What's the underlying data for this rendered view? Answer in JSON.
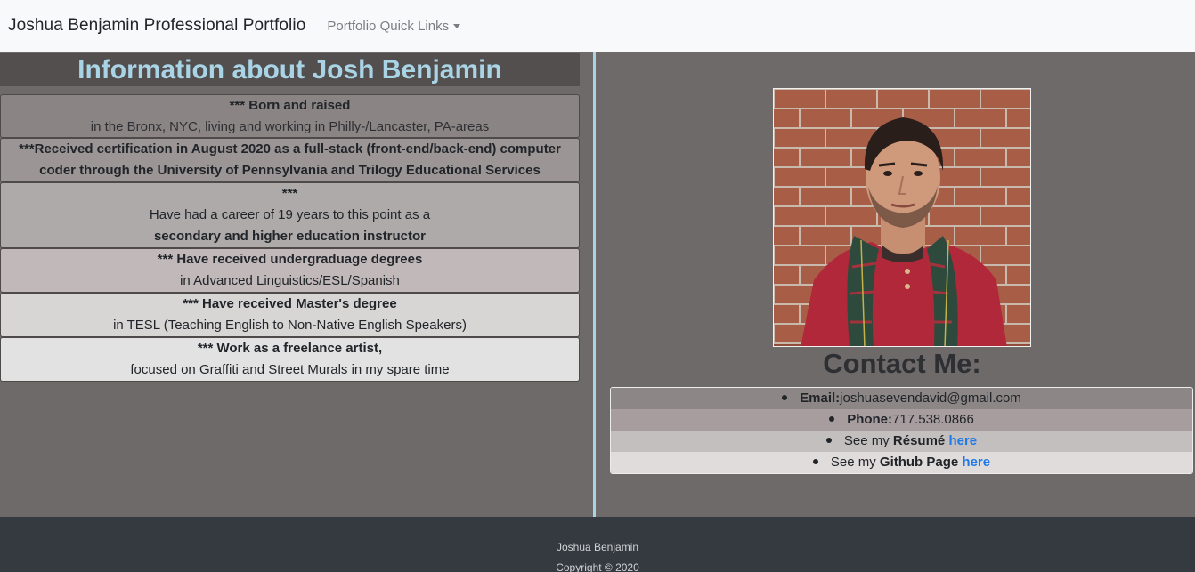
{
  "navbar": {
    "brand": "Joshua Benjamin Professional Portfolio",
    "quick_links": "Portfolio Quick Links"
  },
  "info": {
    "title": "Information about Josh Benjamin",
    "cards": [
      {
        "bold": "*** Born and raised",
        "normal": "in the Bronx, NYC, living and working in Philly-/Lancaster, PA-areas"
      },
      {
        "bold": "***Received certification in August 2020 as a full-stack (front-end/back-end) computer coder through the University of Pennsylvania and Trilogy Educational Services"
      },
      {
        "bold": "***",
        "normal": "Have had a career of 19 years to this point as a",
        "bold2": "secondary and higher education instructor"
      },
      {
        "bold": "*** Have received undergraduage degrees",
        "normal": "in Advanced Linguistics/ESL/Spanish"
      },
      {
        "bold": "*** Have received Master's degree",
        "normal": "in TESL (Teaching English to Non-Native English Speakers)"
      },
      {
        "bold": "*** Work as a freelance artist,",
        "normal": "focused on Graffiti and Street Murals in my spare time"
      }
    ]
  },
  "contact": {
    "title": "Contact Me:",
    "email_label": "Email:",
    "email_value": "joshuasevendavid@gmail.com",
    "phone_label": "Phone:",
    "phone_value": "717.538.0866",
    "resume_prefix": "See my ",
    "resume_bold": "Résumé",
    "resume_link": "here",
    "github_prefix": "See my ",
    "github_bold": "Github Page",
    "github_link": "here"
  },
  "footer": {
    "name": "Joshua Benjamin",
    "copyright": "Copyright © 2020"
  },
  "colors": {
    "accent": "#a9d4e6",
    "link": "#1e7ae8",
    "footer_bg": "#343a40"
  }
}
